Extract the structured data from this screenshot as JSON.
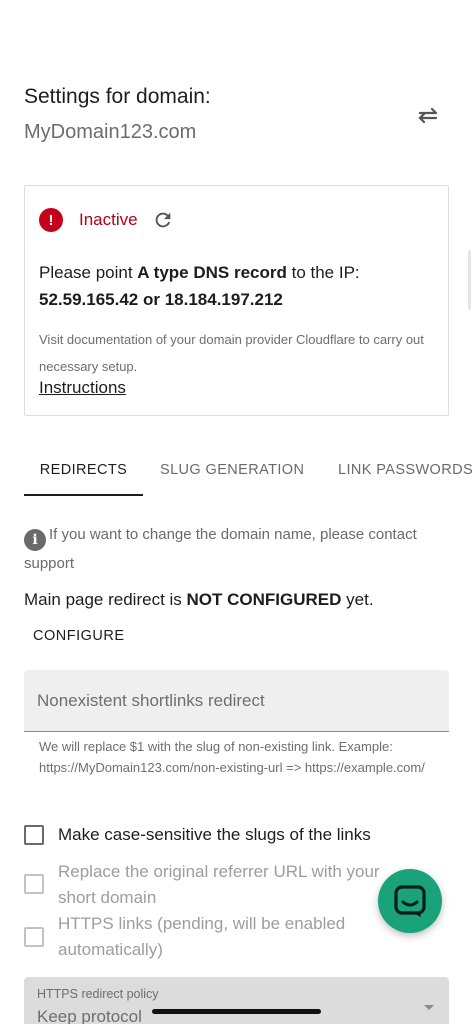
{
  "header": {
    "title": "Settings for domain:",
    "domain": "MyDomain123.com",
    "swap_icon": "swap-arrows-icon"
  },
  "status": {
    "icon": "error-icon",
    "state": "Inactive",
    "refresh_icon": "refresh-icon",
    "point_prefix": "Please point ",
    "record_type": "A type DNS record",
    "point_suffix": " to the IP:",
    "ips": "52.59.165.42 or 18.184.197.212",
    "doc_note": "Visit documentation of your domain provider Cloudflare to carry out necessary setup.",
    "instructions_link": "Instructions",
    "colors": {
      "error": "#c4001a"
    }
  },
  "tabs": [
    {
      "label": "REDIRECTS",
      "active": true
    },
    {
      "label": "SLUG GENERATION",
      "active": false
    },
    {
      "label": "LINK PASSWORDS",
      "active": false
    }
  ],
  "redirects": {
    "info_text": "If you want to change the domain name, please contact support",
    "main_redirect_prefix": "Main page redirect is ",
    "main_redirect_state": "NOT CONFIGURED",
    "main_redirect_suffix": " yet.",
    "configure_button": "CONFIGURE",
    "nonexistent_placeholder": "Nonexistent shortlinks redirect",
    "nonexistent_value": "",
    "helper_text": "We will replace $1 with the slug of non-existing link. Example: https://MyDomain123.com/non-existing-url => https://example.com/",
    "checkboxes": [
      {
        "label": "Make case-sensitive the slugs of the links",
        "checked": false,
        "disabled": false
      },
      {
        "label": "Replace the original referrer URL with your short domain",
        "checked": false,
        "disabled": true
      },
      {
        "label": "HTTPS links (pending, will be enabled automatically)",
        "checked": false,
        "disabled": true
      }
    ],
    "https_policy": {
      "label": "HTTPS redirect policy",
      "value": "Keep protocol"
    }
  },
  "chat_fab": {
    "icon": "chat-icon",
    "color": "#1aa37a"
  }
}
